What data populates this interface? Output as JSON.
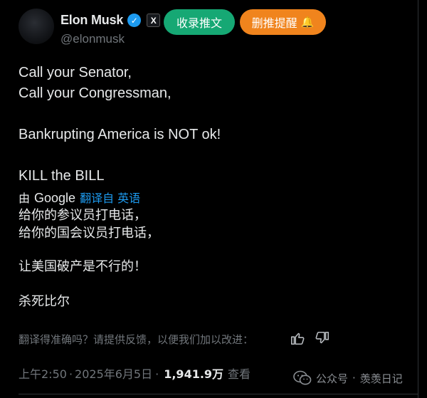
{
  "author": {
    "name": "Elon Musk",
    "handle": "@elonmusk",
    "verified_icon": "verified-badge-icon",
    "affiliation_icon": "x-logo-icon",
    "affiliation_text": "X"
  },
  "actions": {
    "save_label": "收录推文",
    "remind_label": "删推提醒",
    "remind_icon": "bell-icon"
  },
  "tweet": {
    "lines_en": [
      "Call your Senator,",
      "Call your Congressman,",
      "",
      "Bankrupting America is NOT ok!",
      "",
      "KILL the BILL"
    ],
    "translation": {
      "by": "由",
      "provider": "Google",
      "link": "翻译自 英语"
    },
    "lines_zh": [
      "给你的参议员打电话，",
      "给你的国会议员打电话，",
      "让美国破产是不行的！",
      "杀死比尔"
    ]
  },
  "feedback": {
    "prompt": "翻译得准确吗？请提供反馈，以便我们加以改进：",
    "thumbs_up_icon": "thumbs-up-icon",
    "thumbs_down_icon": "thumbs-down-icon"
  },
  "meta": {
    "time": "上午2:50",
    "separator": "·",
    "date": "2025年6月5日",
    "views": "1,941.9万",
    "views_label": "查看"
  },
  "watermark": {
    "icon": "wechat-icon",
    "source": "公众号",
    "separator": "·",
    "account": "羡羡日记"
  },
  "colors": {
    "background": "#000000",
    "text": "#e7e9ea",
    "muted": "#71767b",
    "link": "#1d9bf0",
    "save_button": "#16a874",
    "remind_button": "#f0841d"
  }
}
